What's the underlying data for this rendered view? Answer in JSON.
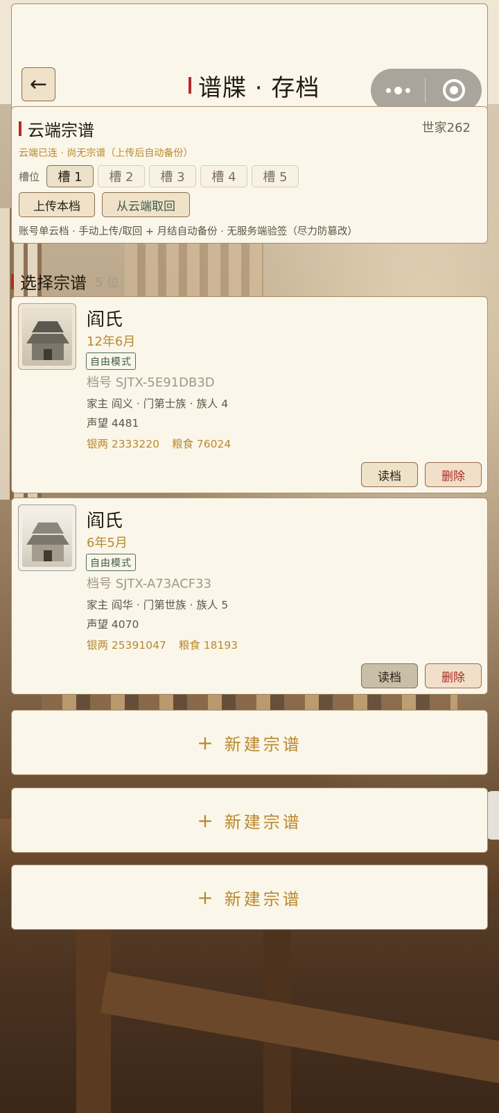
{
  "header": {
    "back_icon": "arrow-left-icon",
    "title": "谱牒 · 存档",
    "capsule_more_icon": "more-dots-icon",
    "capsule_close_icon": "record-target-icon"
  },
  "cloud": {
    "title": "云端宗谱",
    "server": "世家262",
    "status": "云端已连 · 尚无宗谱（上传后自动备份）",
    "slot_label": "槽位",
    "slots": [
      "槽 1",
      "槽 2",
      "槽 3",
      "槽 4",
      "槽 5"
    ],
    "active_slot": 0,
    "upload_label": "上传本档",
    "fetch_label": "从云端取回",
    "note": "账号单云档 · 手动上传/取回 + 月结自动备份 · 无服务端验签（尽力防篡改）"
  },
  "section": {
    "title": "选择宗谱",
    "count": "5 位"
  },
  "saves": [
    {
      "name": "阎氏",
      "date": "12年6月",
      "mode": "自由模式",
      "id": "档号 SJTX-5E91DB3D",
      "head": "家主 阎义 · 门第士族 · 族人 4",
      "fame": "声望 4481",
      "silver": "银两 2333220",
      "grain": "粮食 76024",
      "load_label": "读档",
      "delete_label": "删除"
    },
    {
      "name": "阎氏",
      "date": "6年5月",
      "mode": "自由模式",
      "id": "档号 SJTX-A73ACF33",
      "head": "家主 阎华 · 门第世族 · 族人 5",
      "fame": "声望 4070",
      "silver": "银两 25391047",
      "grain": "粮食 18193",
      "load_label": "读档",
      "delete_label": "删除"
    }
  ],
  "new_slots": [
    {
      "plus": "+",
      "label": "新建宗谱"
    },
    {
      "plus": "+",
      "label": "新建宗谱"
    },
    {
      "plus": "+",
      "label": "新建宗谱"
    }
  ],
  "colors": {
    "accent_red": "#b52a23",
    "gold_text": "#b8892e",
    "panel_bg": "#fbf6ea",
    "border": "#a88d68",
    "jade": "#3d5a4a"
  }
}
